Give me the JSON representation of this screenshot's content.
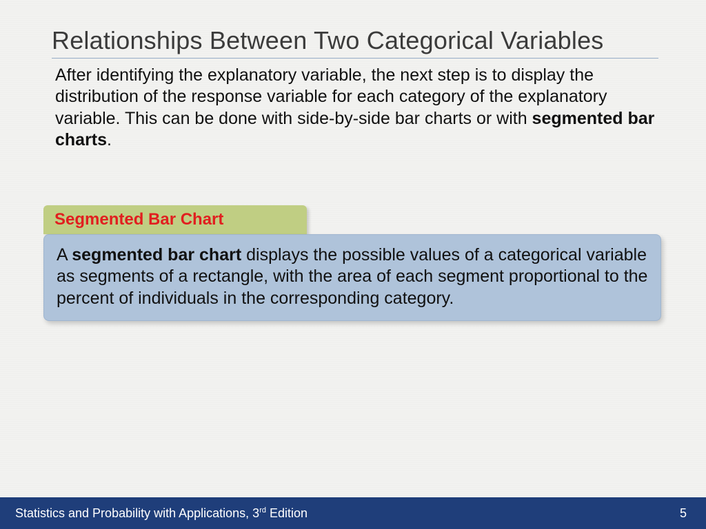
{
  "title": "Relationships Between Two Categorical Variables",
  "paragraph": {
    "pre": "After identifying the explanatory variable, the next step is to display the distribution of the response variable for each category of the explanatory variable. This can be done with side-by-side bar charts or with ",
    "bold": "segmented bar charts",
    "post": "."
  },
  "term": {
    "label": "Segmented Bar Chart"
  },
  "definition": {
    "pre": "A ",
    "bold": "segmented bar chart",
    "post": " displays the possible values of a categorical variable as segments of a rectangle, with the area of each segment proportional to the percent of individuals in the corresponding category."
  },
  "footer": {
    "book_pre": "Statistics and Probability with Applications, 3",
    "book_sup": "rd",
    "book_post": " Edition",
    "page_number": "5"
  }
}
